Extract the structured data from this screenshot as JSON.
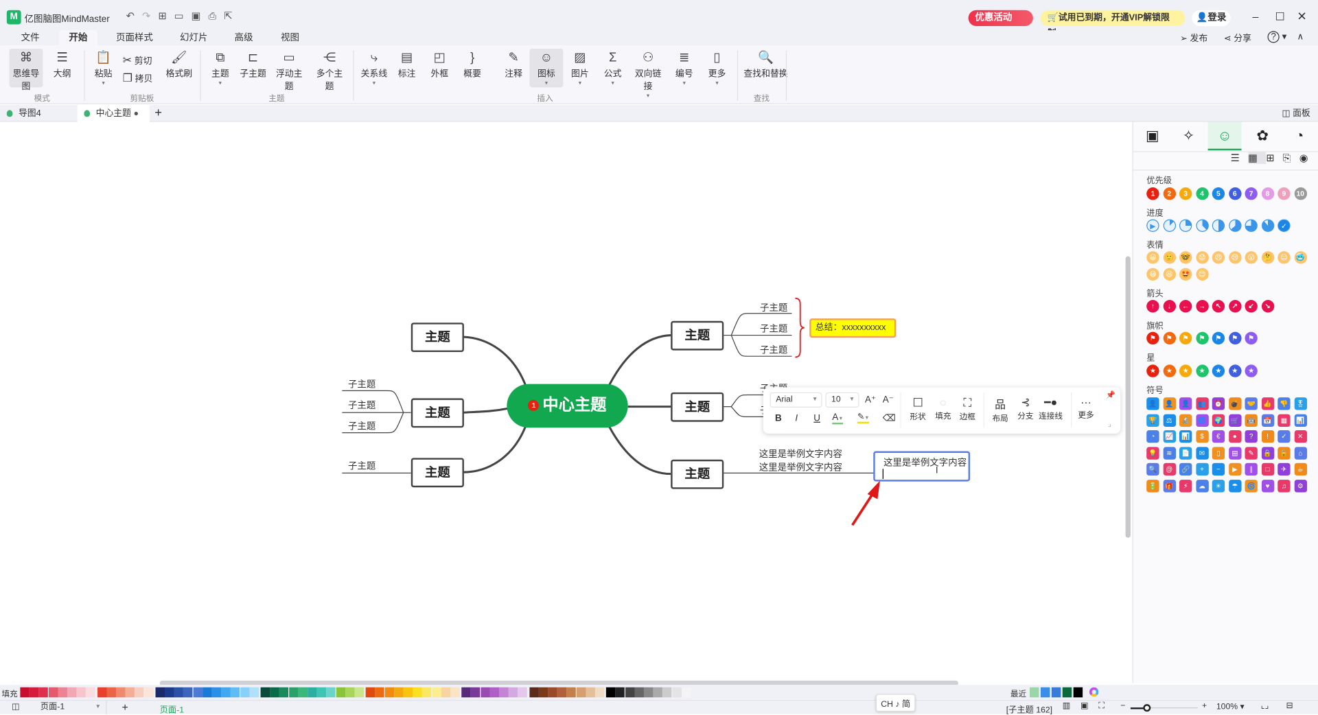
{
  "app": {
    "title": "亿图脑图MindMaster",
    "promo": "优惠活动",
    "vip_notice": "试用已到期，开通VIP解锁限制。",
    "login": "登录",
    "publish": "发布",
    "share": "分享",
    "help": "?"
  },
  "menu": [
    "文件",
    "开始",
    "页面样式",
    "幻灯片",
    "高级",
    "视图"
  ],
  "menu_active": "开始",
  "ribbon": {
    "buttons": [
      {
        "label": "思维导图",
        "icon": "mindmap-icon",
        "g": "⌘"
      },
      {
        "label": "大纲",
        "icon": "outline-icon",
        "g": "☰"
      },
      {
        "label": "粘贴",
        "icon": "paste-icon",
        "g": "📋"
      },
      {
        "label": "格式刷",
        "icon": "format-brush-icon",
        "g": "🖌"
      },
      {
        "label": "主题",
        "icon": "topic-icon",
        "g": "⧉"
      },
      {
        "label": "子主题",
        "icon": "subtopic-icon",
        "g": "⊏"
      },
      {
        "label": "浮动主题",
        "icon": "floating-topic-icon",
        "g": "▭"
      },
      {
        "label": "多个主题",
        "icon": "multiple-topics-icon",
        "g": "⋲"
      },
      {
        "label": "关系线",
        "icon": "relationship-icon",
        "g": "⤷"
      },
      {
        "label": "标注",
        "icon": "callout-icon",
        "g": "▤"
      },
      {
        "label": "外框",
        "icon": "boundary-icon",
        "g": "◰"
      },
      {
        "label": "概要",
        "icon": "summary-icon",
        "g": "}"
      },
      {
        "label": "注释",
        "icon": "note-icon",
        "g": "✎"
      },
      {
        "label": "图标",
        "icon": "icon-insert-icon",
        "g": "☺"
      },
      {
        "label": "图片",
        "icon": "image-icon",
        "g": "▨"
      },
      {
        "label": "公式",
        "icon": "formula-icon",
        "g": "Σ"
      },
      {
        "label": "双向链接",
        "icon": "bilink-icon",
        "g": "⚇"
      },
      {
        "label": "编号",
        "icon": "numbering-icon",
        "g": "≣"
      },
      {
        "label": "更多",
        "icon": "more-icon",
        "g": "▯"
      },
      {
        "label": "查找和替换",
        "icon": "find-replace-icon",
        "g": "🔍"
      }
    ],
    "cut": "剪切",
    "copy": "拷贝",
    "groups": [
      "模式",
      "剪贴板",
      "主题",
      "插入",
      "查找"
    ]
  },
  "tabs": [
    {
      "label": "导图4"
    },
    {
      "label": "中心主题",
      "modified": true
    }
  ],
  "panel_toggle": "面板",
  "map": {
    "center": "中心主题",
    "center_badge": "1",
    "topic": "主题",
    "subtopic": "子主题",
    "summary": "总结：xxxxxxxxxx",
    "sample_text": "这里是举例文字内容",
    "editing_text": "这里是举例文字内容",
    "center_color": "#11a84f",
    "summary_fill": "#ffff00",
    "bracket_color": "#e02020",
    "edit_border": "#5b7ce6"
  },
  "float_toolbar": {
    "font": "Arial",
    "size": "10",
    "shape": "形状",
    "fill": "填充",
    "border": "边框",
    "layout": "布局",
    "branch": "分支",
    "connector": "连接线",
    "more": "更多"
  },
  "panel": {
    "sections": {
      "priority": "优先级",
      "progress": "进度",
      "emotion": "表情",
      "arrow": "箭头",
      "flag": "旗帜",
      "star": "星",
      "symbol": "符号"
    },
    "priority": [
      "1",
      "2",
      "3",
      "4",
      "5",
      "6",
      "7",
      "8",
      "9",
      "10"
    ],
    "priority_colors": [
      "#e8200e",
      "#f26a0f",
      "#f7a90c",
      "#1ec46a",
      "#1a86e8",
      "#3f5fe0",
      "#8e5cf0",
      "#e59ae8",
      "#eea0bc",
      "#9a9a9a"
    ],
    "colors7": [
      "#e8200e",
      "#f26a0f",
      "#f7a90c",
      "#1ec46a",
      "#1a86e8",
      "#3f5fe0",
      "#8e5cf0"
    ],
    "arrows": [
      "↑",
      "↓",
      "←",
      "→",
      "↖",
      "↗",
      "↙",
      "↘"
    ],
    "arrow_color": "#e8104f",
    "symbol_colors": [
      "#1a8ee8",
      "#e83a6a",
      "#5a7ce8",
      "#2aa0e8",
      "#a050e8",
      "#f08a1a",
      "#4a80e8",
      "#f09020",
      "#9040d8",
      "#e83a6a"
    ]
  },
  "palette": {
    "fill_label": "填充",
    "recent_label": "最近"
  },
  "status": {
    "page_select": "页面-1",
    "page_tab": "页面-1",
    "selection": "[子主题 162]",
    "zoom": "100%",
    "ime": "CH ♪ 简"
  }
}
